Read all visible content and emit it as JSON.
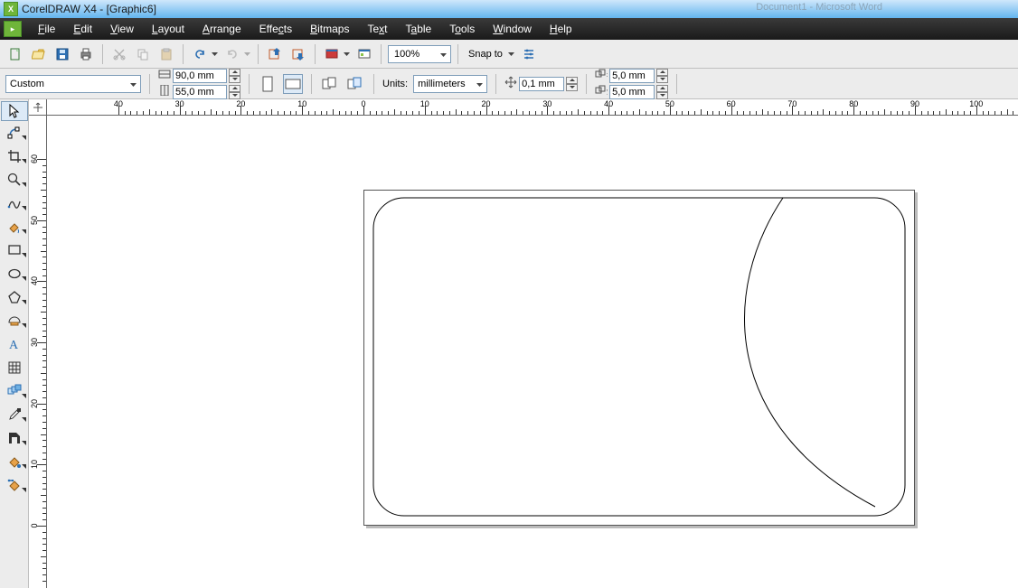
{
  "app": {
    "title": "CorelDRAW X4 - [Graphic6]",
    "bg_hint": "Document1 - Microsoft Word"
  },
  "menu": {
    "items": [
      "File",
      "Edit",
      "View",
      "Layout",
      "Arrange",
      "Effects",
      "Bitmaps",
      "Text",
      "Table",
      "Tools",
      "Window",
      "Help"
    ]
  },
  "standard_toolbar": {
    "zoom": "100%",
    "snap_label": "Snap to"
  },
  "property_bar": {
    "paper_preset": "Custom",
    "width": "90,0 mm",
    "height": "55,0 mm",
    "units_label": "Units:",
    "units_value": "millimeters",
    "nudge": "0,1 mm",
    "dup_x": "5,0 mm",
    "dup_y": "5,0 mm"
  },
  "ruler": {
    "h_labels": [
      "40",
      "30",
      "20",
      "10",
      "0",
      "10",
      "20",
      "30",
      "40",
      "50",
      "60",
      "70",
      "80",
      "90",
      "100"
    ],
    "v_labels": [
      "60",
      "50",
      "40",
      "30",
      "20",
      "10",
      "0"
    ]
  },
  "tools": [
    {
      "name": "pick-tool",
      "active": true
    },
    {
      "name": "shape-tool"
    },
    {
      "name": "crop-tool"
    },
    {
      "name": "zoom-tool"
    },
    {
      "name": "freehand-tool"
    },
    {
      "name": "smart-fill-tool"
    },
    {
      "name": "rectangle-tool"
    },
    {
      "name": "ellipse-tool"
    },
    {
      "name": "polygon-tool"
    },
    {
      "name": "basic-shapes-tool"
    },
    {
      "name": "text-tool"
    },
    {
      "name": "table-tool"
    },
    {
      "name": "interactive-blend-tool"
    },
    {
      "name": "eyedropper-tool"
    },
    {
      "name": "outline-tool"
    },
    {
      "name": "fill-tool"
    },
    {
      "name": "interactive-fill-tool"
    }
  ]
}
